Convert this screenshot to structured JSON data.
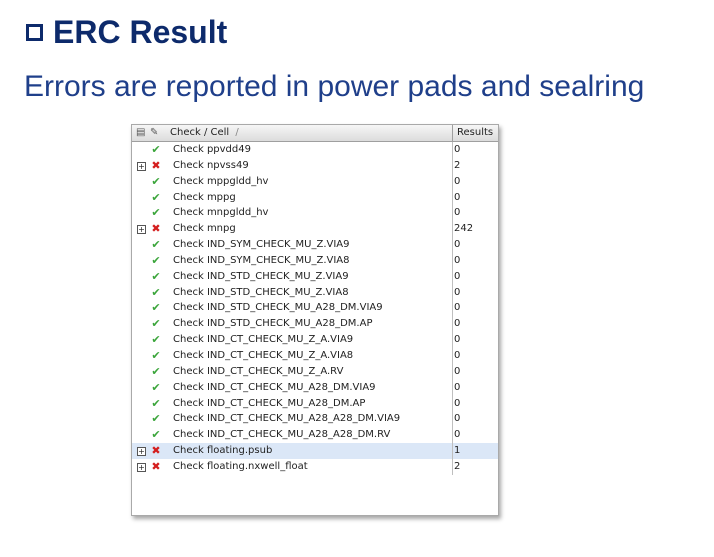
{
  "slide": {
    "title": "ERC Result",
    "subtitle": "Errors are reported in power pads and sealring"
  },
  "table": {
    "col_check": "Check / Cell",
    "col_results": "Results",
    "sort_indicator": "/",
    "rows": [
      {
        "name": "Check ppvdd49",
        "result": "0",
        "status": "ok",
        "expandable": false,
        "selected": false
      },
      {
        "name": "Check npvss49",
        "result": "2",
        "status": "err",
        "expandable": true,
        "selected": false
      },
      {
        "name": "Check mppgldd_hv",
        "result": "0",
        "status": "ok",
        "expandable": false,
        "selected": false
      },
      {
        "name": "Check mppg",
        "result": "0",
        "status": "ok",
        "expandable": false,
        "selected": false
      },
      {
        "name": "Check mnpgldd_hv",
        "result": "0",
        "status": "ok",
        "expandable": false,
        "selected": false
      },
      {
        "name": "Check mnpg",
        "result": "242",
        "status": "err",
        "expandable": true,
        "selected": false
      },
      {
        "name": "Check IND_SYM_CHECK_MU_Z.VIA9",
        "result": "0",
        "status": "ok",
        "expandable": false,
        "selected": false
      },
      {
        "name": "Check IND_SYM_CHECK_MU_Z.VIA8",
        "result": "0",
        "status": "ok",
        "expandable": false,
        "selected": false
      },
      {
        "name": "Check IND_STD_CHECK_MU_Z.VIA9",
        "result": "0",
        "status": "ok",
        "expandable": false,
        "selected": false
      },
      {
        "name": "Check IND_STD_CHECK_MU_Z.VIA8",
        "result": "0",
        "status": "ok",
        "expandable": false,
        "selected": false
      },
      {
        "name": "Check IND_STD_CHECK_MU_A28_DM.VIA9",
        "result": "0",
        "status": "ok",
        "expandable": false,
        "selected": false
      },
      {
        "name": "Check IND_STD_CHECK_MU_A28_DM.AP",
        "result": "0",
        "status": "ok",
        "expandable": false,
        "selected": false
      },
      {
        "name": "Check IND_CT_CHECK_MU_Z_A.VIA9",
        "result": "0",
        "status": "ok",
        "expandable": false,
        "selected": false
      },
      {
        "name": "Check IND_CT_CHECK_MU_Z_A.VIA8",
        "result": "0",
        "status": "ok",
        "expandable": false,
        "selected": false
      },
      {
        "name": "Check IND_CT_CHECK_MU_Z_A.RV",
        "result": "0",
        "status": "ok",
        "expandable": false,
        "selected": false
      },
      {
        "name": "Check IND_CT_CHECK_MU_A28_DM.VIA9",
        "result": "0",
        "status": "ok",
        "expandable": false,
        "selected": false
      },
      {
        "name": "Check IND_CT_CHECK_MU_A28_DM.AP",
        "result": "0",
        "status": "ok",
        "expandable": false,
        "selected": false
      },
      {
        "name": "Check IND_CT_CHECK_MU_A28_A28_DM.VIA9",
        "result": "0",
        "status": "ok",
        "expandable": false,
        "selected": false
      },
      {
        "name": "Check IND_CT_CHECK_MU_A28_A28_DM.RV",
        "result": "0",
        "status": "ok",
        "expandable": false,
        "selected": false
      },
      {
        "name": "Check floating.psub",
        "result": "1",
        "status": "err",
        "expandable": true,
        "selected": true
      },
      {
        "name": "Check floating.nxwell_float",
        "result": "2",
        "status": "err",
        "expandable": true,
        "selected": false
      }
    ]
  }
}
